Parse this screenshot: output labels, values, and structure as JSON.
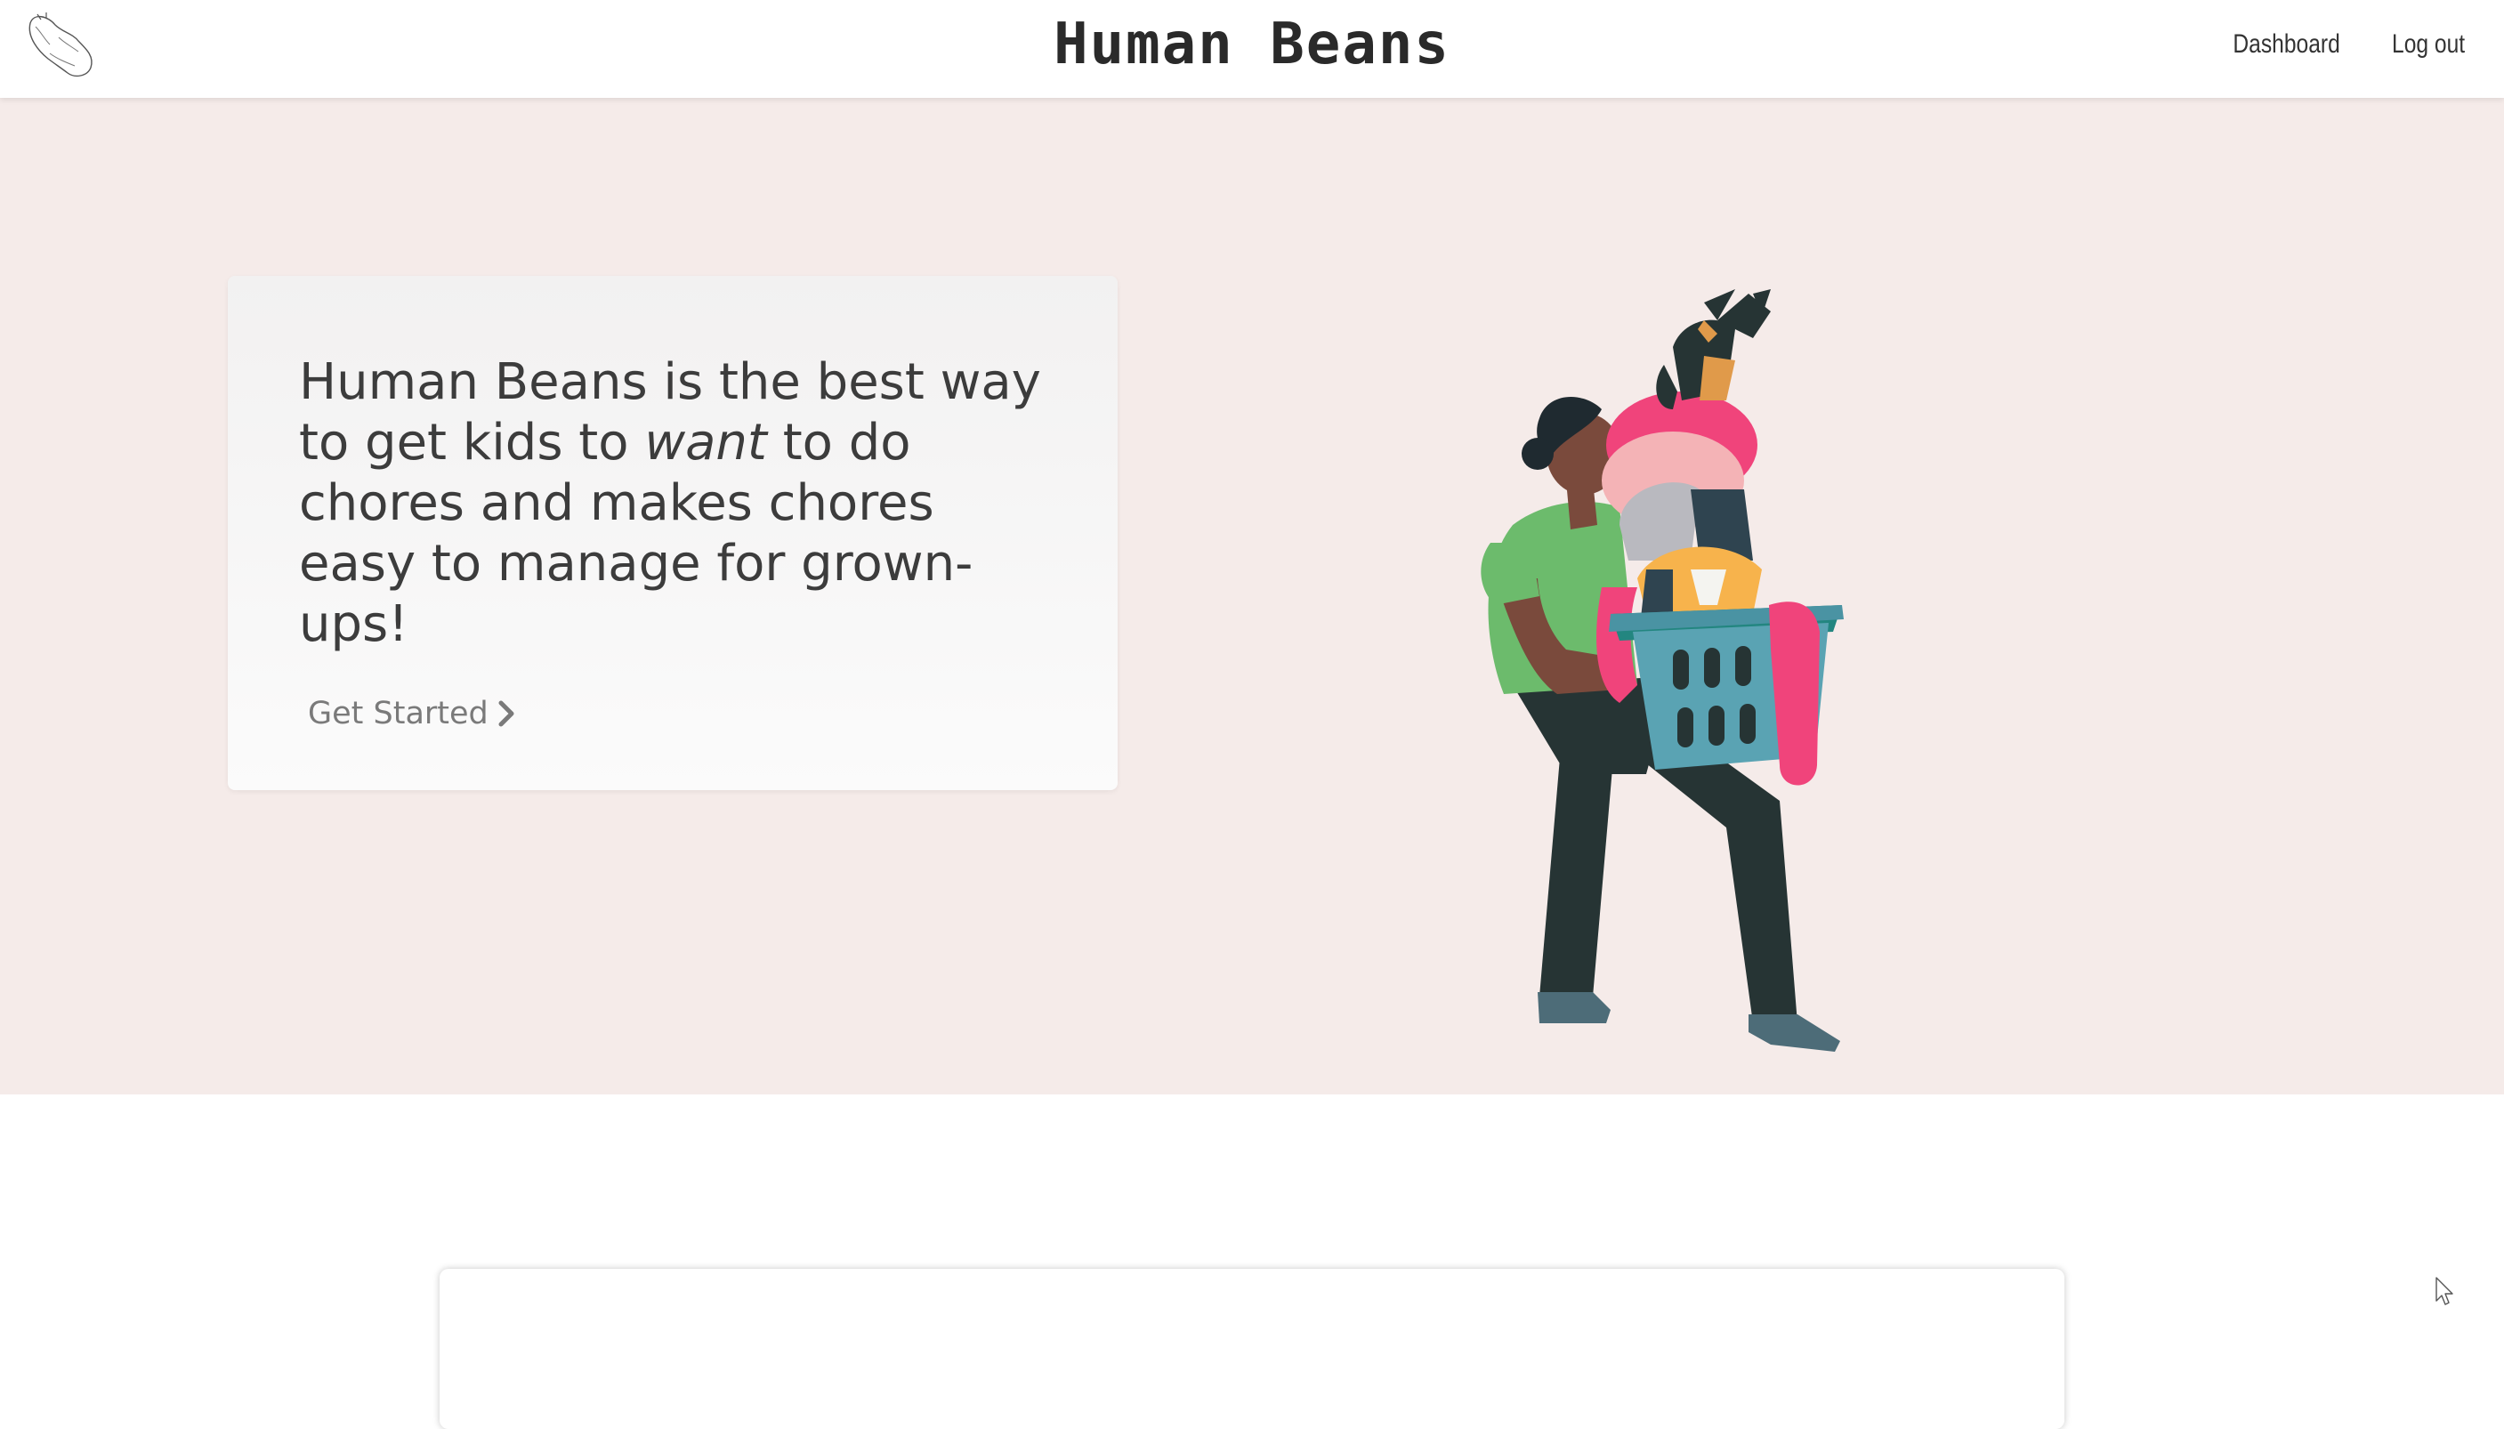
{
  "nav": {
    "brand": "Human Beans",
    "links": [
      "Dashboard",
      "Log out"
    ]
  },
  "hero": {
    "text_before": "Human Beans is the best way to get kids to ",
    "text_emphasis": "want",
    "text_after": " to do chores and makes chores easy to manage for grown-ups!",
    "cta_label": "Get Started"
  },
  "icons": {
    "logo": "bean-logo-icon",
    "cta_arrow": "chevron-right-icon",
    "cursor": "mouse-cursor-icon"
  },
  "colors": {
    "hero_background": "#f5ebe9",
    "shirt": "#6cbb6c",
    "pants": "#263434",
    "basket": "#5aa3b3",
    "accent_pink": "#f0447b"
  }
}
